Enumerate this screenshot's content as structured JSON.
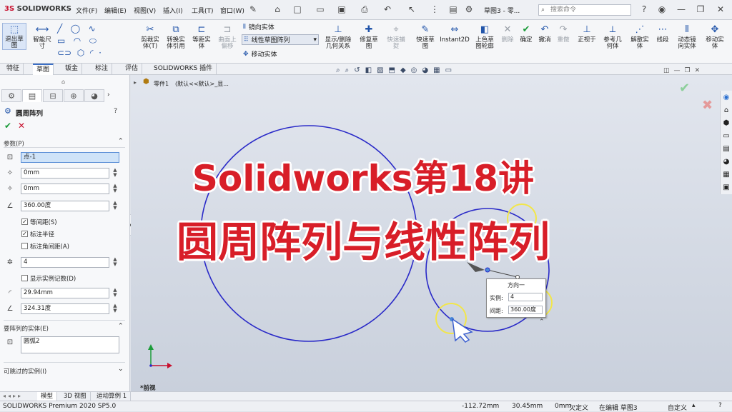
{
  "app": {
    "brand_ds": "3S",
    "brand_name": "SOLIDWORKS",
    "doc_title": "草图3 - 零...",
    "search_placeholder": "搜索命令"
  },
  "menu": [
    "文件(F)",
    "编辑(E)",
    "视图(V)",
    "插入(I)",
    "工具(T)",
    "窗口(W)"
  ],
  "commands": {
    "exit_sketch": "退出草\n图",
    "smart_dim": "智能尺\n寸",
    "trim": "剪裁实\n体(T)",
    "convert": "转换实\n体引用",
    "offset": "等距实\n体",
    "offset_surface": "曲面上\n偏移",
    "mirror": "镜向实体",
    "linear_pattern": "线性草图阵列",
    "move": "移动实体",
    "show_delete": "显示/删除\n几何关系",
    "repair": "修复草\n图",
    "quick_snap": "快速捕\n捉",
    "quick_sketch": "快速草\n图",
    "instant2d": "Instant2D",
    "shaded": "上色草\n图轮廓",
    "delete": "删除",
    "ok": "确定",
    "undo": "撤消",
    "redo": "重做",
    "normal_to": "正视于",
    "ref_geom": "参考几\n何体",
    "dissolve": "解散实\n体",
    "segment": "线段",
    "dyn_mirror": "动态镜\n向实体",
    "move_copy": "移动实\n体"
  },
  "tabs": [
    "特征",
    "草图",
    "钣金",
    "标注",
    "评估",
    "SOLIDWORKS 插件"
  ],
  "active_tab": "草图",
  "tree": {
    "part": "零件1",
    "state": "(默认<<默认>_显..."
  },
  "feature": {
    "title": "圆周阵列",
    "params_header": "参数(P)",
    "center_point": "点-1",
    "x": "0mm",
    "y": "0mm",
    "angle": "360.00度",
    "equal_spacing": "等间距(S)",
    "dim_radius": "标注半径",
    "dim_angle_spacing": "标注角间距(A)",
    "instances": "4",
    "show_count": "显示实例记数(D)",
    "radius": "29.94mm",
    "arc_angle": "324.31度",
    "entities_header": "要阵列的实体(E)",
    "entity": "圆弧2",
    "skip_header": "可跳过的实例(I)"
  },
  "checks": {
    "equal_spacing": true,
    "dim_radius": true,
    "dim_angle_spacing": false,
    "show_count": false
  },
  "overlay": {
    "line1": "Solidworks第18讲",
    "line2": "圆周阵列与线性阵列"
  },
  "popup": {
    "title": "方向一",
    "instances_label": "实例:",
    "instances_value": "4",
    "spacing_label": "间距:",
    "spacing_value": "360.00度"
  },
  "view_label": "*前视",
  "bottom_tabs": [
    "模型",
    "3D 视图",
    "运动算例 1"
  ],
  "status": {
    "product": "SOLIDWORKS Premium 2020 SP5.0",
    "x": "-112.72mm",
    "y": "30.45mm",
    "z": "0mm",
    "state": "欠定义",
    "edit": "在编辑 草图3",
    "custom": "自定义"
  },
  "colors": {
    "sketch_blue": "#2a2ac8",
    "overlay_red": "#d81e28",
    "highlight_yellow": "#f2e64a",
    "accent": "#3b6fc6"
  }
}
